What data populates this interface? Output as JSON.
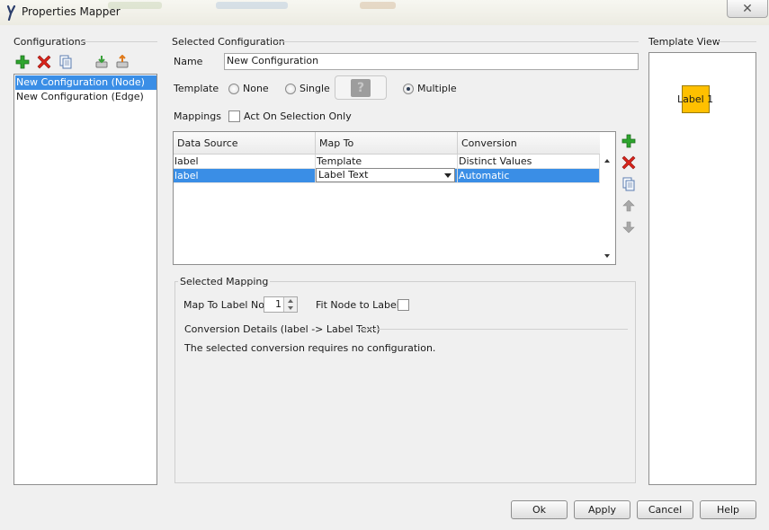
{
  "window": {
    "title": "Properties Mapper",
    "close_glyph": "✕"
  },
  "configurations": {
    "title": "Configurations",
    "toolbar": [
      {
        "name": "add-configuration-button",
        "icon": "plus-icon",
        "color": "#2ea52e"
      },
      {
        "name": "remove-configuration-button",
        "icon": "x-icon",
        "color": "#d9241b"
      },
      {
        "name": "copy-configuration-button",
        "icon": "copy-icon",
        "color": "#5b7db0"
      },
      {
        "name": "import-configuration-button",
        "icon": "import-icon",
        "color": "#3aa03a"
      },
      {
        "name": "export-configuration-button",
        "icon": "export-icon",
        "color": "#e07a1a"
      }
    ],
    "items": [
      {
        "label": "New Configuration (Node)",
        "selected": true
      },
      {
        "label": "New Configuration (Edge)",
        "selected": false
      }
    ]
  },
  "selected_configuration": {
    "title": "Selected Configuration",
    "name_label": "Name",
    "name_value": "New Configuration",
    "template_label": "Template",
    "template_options": [
      {
        "label": "None",
        "checked": false
      },
      {
        "label": "Single",
        "checked": false
      },
      {
        "label": "Multiple",
        "checked": true
      }
    ],
    "template_preview_glyph": "?",
    "mappings_label": "Mappings",
    "act_on_selection_label": "Act On Selection Only",
    "act_on_selection_checked": false
  },
  "mappings_table": {
    "columns": [
      "Data Source",
      "Map To",
      "Conversion"
    ],
    "rows": [
      {
        "data_source": "label",
        "map_to": "Template",
        "conversion": "Distinct Values",
        "selected": false
      },
      {
        "data_source": "label",
        "map_to": "Label Text",
        "conversion": "Automatic",
        "selected": true
      }
    ],
    "side_buttons": [
      {
        "name": "add-mapping-button",
        "icon": "plus-icon",
        "color": "#2ea52e"
      },
      {
        "name": "remove-mapping-button",
        "icon": "x-icon",
        "color": "#d9241b"
      },
      {
        "name": "copy-mapping-button",
        "icon": "copy-icon",
        "color": "#5b7db0"
      },
      {
        "name": "move-up-button",
        "icon": "arrow-up-icon",
        "color": "#9a9a9a"
      },
      {
        "name": "move-down-button",
        "icon": "arrow-down-icon",
        "color": "#9a9a9a"
      }
    ]
  },
  "selected_mapping": {
    "title": "Selected Mapping",
    "map_to_label_no_label": "Map To Label No.",
    "map_to_label_no_value": "1",
    "fit_node_label": "Fit Node to Label",
    "fit_node_checked": false,
    "conversion_details_title": "Conversion Details (label -> Label Text)",
    "conversion_details_text": "The selected conversion requires no configuration."
  },
  "template_view": {
    "title": "Template View",
    "node_label": "Label 1",
    "node_color": "#ffc000"
  },
  "buttons": {
    "ok": "Ok",
    "apply": "Apply",
    "cancel": "Cancel",
    "help": "Help"
  },
  "colors": {
    "selection": "#3a8ee6",
    "window_bg": "#f0f0f0"
  }
}
